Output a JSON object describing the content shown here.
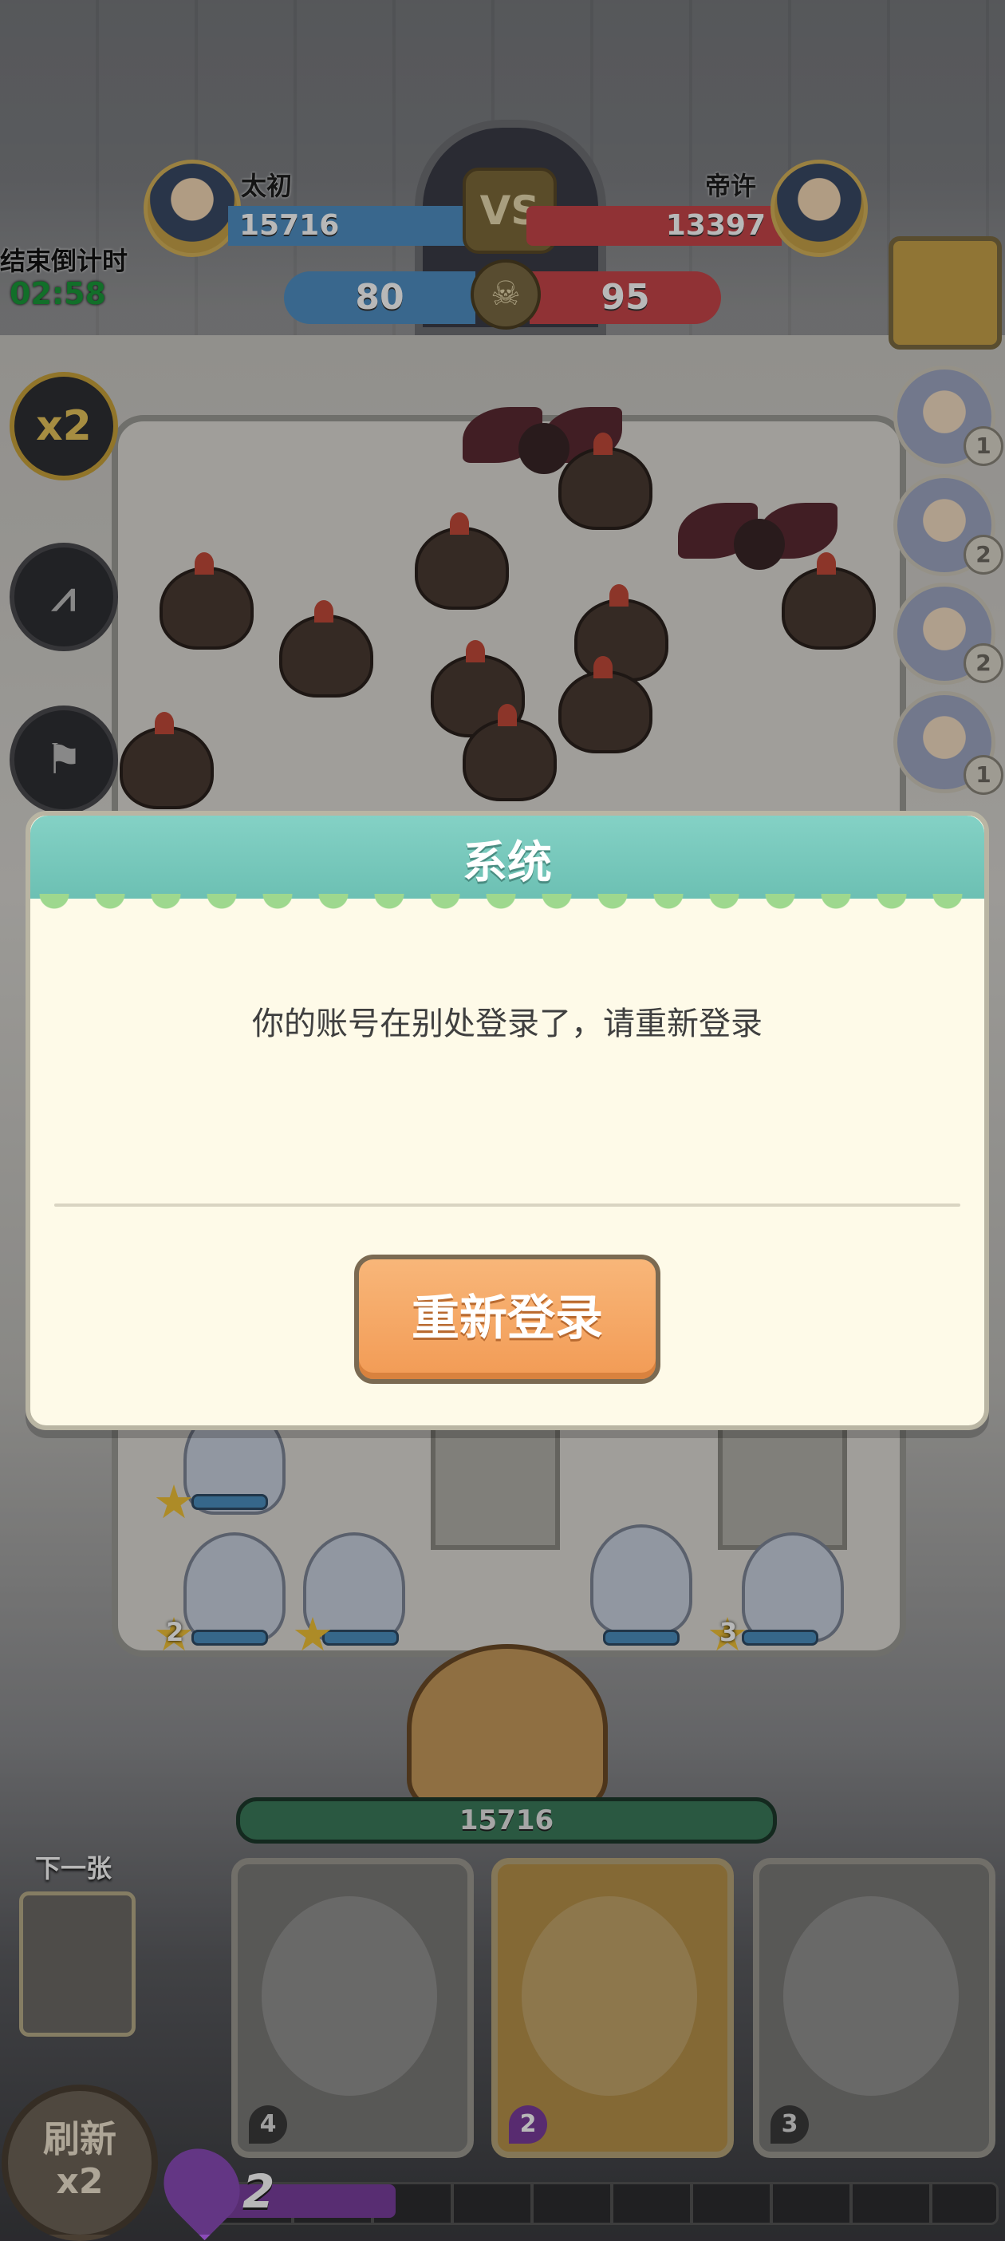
{
  "scoreboard": {
    "left_player": {
      "name": "太初",
      "score": "15716"
    },
    "right_player": {
      "name": "帝许",
      "score": "13397"
    },
    "vs_label": "VS",
    "left_kills": "80",
    "right_kills": "95"
  },
  "timer": {
    "label": "结束倒计时",
    "value": "02:58"
  },
  "controls": {
    "speed_label": "x2"
  },
  "hero_slots": [
    {
      "count": "1"
    },
    {
      "count": "2"
    },
    {
      "count": "2"
    },
    {
      "count": "1"
    }
  ],
  "board": {
    "unit_stars": [
      "2",
      "3"
    ],
    "king_hp": "15716"
  },
  "cards": {
    "next_label": "下一张",
    "hand": [
      {
        "cost": "4"
      },
      {
        "cost": "2"
      },
      {
        "cost": "3"
      }
    ],
    "refresh_label": "刷新",
    "refresh_multiplier": "x2"
  },
  "elixir": {
    "count": "2"
  },
  "dialog": {
    "title": "系统",
    "message": "你的账号在别处登录了，请重新登录",
    "button_label": "重新登录"
  },
  "colors": {
    "left_team": "#4f8fc4",
    "right_team": "#c8464a",
    "dialog_header": "#7cc9bd",
    "button_accent": "#f4a562",
    "elixir": "#7a3f9e"
  }
}
